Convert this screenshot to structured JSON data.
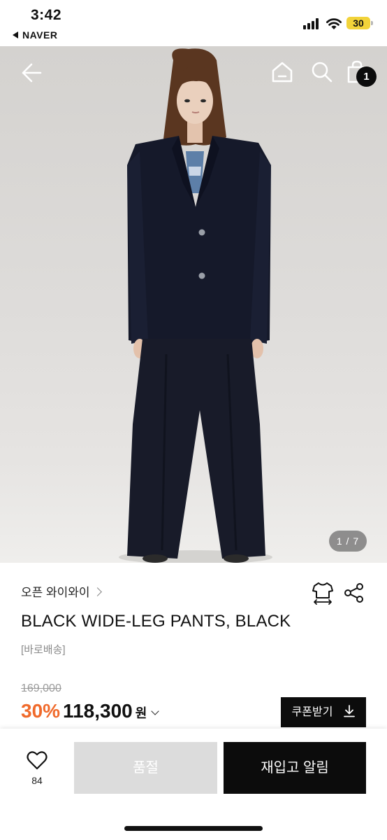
{
  "status_bar": {
    "time": "3:42",
    "back_app": "NAVER",
    "battery": "30"
  },
  "header": {
    "back_icon": "arrow-left-icon",
    "home_icon": "home-icon",
    "search_icon": "search-icon",
    "cart_icon": "shopping-bag-icon",
    "cart_count": "1"
  },
  "gallery": {
    "pager": "1 / 7"
  },
  "product": {
    "brand": "오픈 와이와이",
    "title": "BLACK WIDE-LEG PANTS, BLACK",
    "delivery_tag": "[바로배송]",
    "original_price": "169,000",
    "discount": "30%",
    "sale_price": "118,300",
    "currency": "원",
    "coupon_button": "쿠폰받기",
    "size_icon": "size-guide-shirt-icon",
    "share_icon": "share-icon"
  },
  "bottom_bar": {
    "like_count": "84",
    "soldout_label": "품절",
    "restock_label": "재입고 알림"
  },
  "colors": {
    "discount": "#f06a2b",
    "primary_button": "#0c0c0c",
    "disabled_button": "#dcdcdc"
  }
}
